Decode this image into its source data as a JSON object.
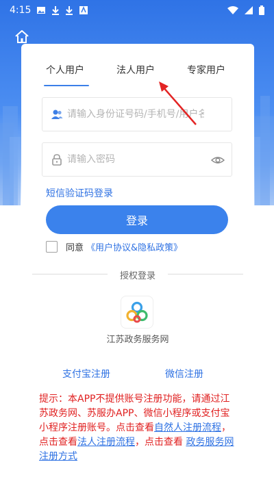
{
  "status_bar": {
    "time": "4:15"
  },
  "tabs": [
    {
      "label": "个人用户"
    },
    {
      "label": "法人用户"
    },
    {
      "label": "专家用户"
    }
  ],
  "username_field": {
    "placeholder": "请输入身份证号码/手机号/用户名",
    "icon": "user-icon"
  },
  "password_field": {
    "placeholder": "请输入密码",
    "icon": "lock-icon"
  },
  "sms_login_label": "短信验证码登录",
  "login_button_label": "登录",
  "agreement": {
    "prefix": "同意",
    "link": "《用户协议&隐私政策》"
  },
  "authorized_login": {
    "divider_label": "授权登录",
    "provider_name": "江苏政务服务网"
  },
  "register_links": {
    "alipay": "支付宝注册",
    "wechat": "微信注册"
  },
  "notice": {
    "text_1": "提示：本APP不提供账号注册功能，请通过江苏政务网、苏服办APP、微信小程序或支付宝小程序注册账号。点击查看",
    "link_1": "自然人注册流程",
    "text_2": "，点击查看",
    "link_2": "法人注册流程",
    "text_3": "，点击查看 ",
    "link_3": "政务服务网注册方式"
  },
  "colors": {
    "accent": "#3b82ec",
    "link": "#2f72e3",
    "notice": "#e02020"
  }
}
